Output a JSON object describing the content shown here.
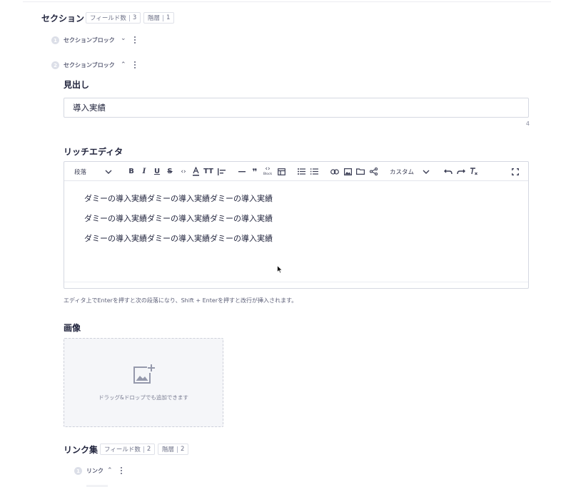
{
  "section": {
    "title": "セクション",
    "field_count_label": "フィールド数",
    "field_count": "3",
    "depth_label": "階層",
    "depth": "1"
  },
  "blocks": [
    {
      "number": "1",
      "label": "セクションブロック",
      "chevron": "⌄"
    },
    {
      "number": "2",
      "label": "セクションブロック",
      "chevron": "⌃"
    }
  ],
  "heading_field": {
    "title": "見出し",
    "value": "導入実績",
    "counter": "4"
  },
  "rich_editor": {
    "title": "リッチエディタ",
    "paragraph_select": "段落",
    "custom_select": "カスタム",
    "icons": [
      "bold-icon",
      "italic-icon",
      "underline-icon",
      "strikethrough-icon",
      "code-icon",
      "text-color-icon",
      "text-size-icon",
      "align-icon",
      "horizontal-rule-icon",
      "quote-icon",
      "code-block-icon",
      "table-icon",
      "bullet-list-icon",
      "numbered-list-icon",
      "link-icon",
      "image-icon",
      "folder-icon",
      "share-icon",
      "undo-icon",
      "redo-icon",
      "clear-format-icon",
      "fullscreen-icon"
    ],
    "block_label": "Block",
    "paragraphs": [
      "ダミーの導入実績ダミーの導入実績ダミーの導入実績",
      "ダミーの導入実績ダミーの導入実績ダミーの導入実績",
      "ダミーの導入実績ダミーの導入実績ダミーの導入実績"
    ],
    "hint": "エディタ上でEnterを押すと次の段落になり、Shift + Enterを押すと改行が挿入されます。"
  },
  "image_field": {
    "title": "画像",
    "drop_text": "ドラッグ&ドロップでも追加できます"
  },
  "link_collection": {
    "title": "リンク集",
    "field_count_label": "フィールド数",
    "field_count": "2",
    "depth_label": "階層",
    "depth": "2",
    "item_number": "1",
    "item_label": "リンク",
    "item_chevron": "⌃"
  },
  "colors": {
    "text": "#21243d",
    "muted": "#5d6078",
    "border": "#d5d8e1",
    "dropzone_bg": "#f5f6f9"
  }
}
